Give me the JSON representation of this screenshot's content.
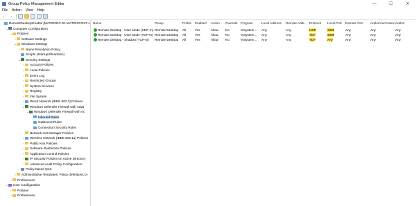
{
  "window": {
    "title": "Group Policy Management Editor",
    "minimize": "—",
    "maximize": "☐",
    "close": "✕"
  },
  "menu": [
    "File",
    "Action",
    "View",
    "Help"
  ],
  "tree": [
    {
      "label": "RemoteDesktopEnable [MATRIXDC-01.MATRIXPOST-LAB",
      "icon": "gpo-icon",
      "exp": "",
      "indent": 0
    },
    {
      "label": "Computer Configuration",
      "icon": "computer-icon",
      "exp": "⌄",
      "indent": 1
    },
    {
      "label": "Policies",
      "icon": "folder-icon",
      "exp": "⌄",
      "indent": 2
    },
    {
      "label": "Software Settings",
      "icon": "folder-icon",
      "exp": "›",
      "indent": 3
    },
    {
      "label": "Windows Settings",
      "icon": "folder-icon",
      "exp": "⌄",
      "indent": 3
    },
    {
      "label": "Name Resolution Policy",
      "icon": "folder-icon",
      "exp": "›",
      "indent": 4
    },
    {
      "label": "Scripts (Startup/Shutdown)",
      "icon": "doc-icon",
      "exp": "",
      "indent": 4
    },
    {
      "label": "Security Settings",
      "icon": "shield-icon",
      "exp": "⌄",
      "indent": 4
    },
    {
      "label": "Account Policies",
      "icon": "folder-icon",
      "exp": "›",
      "indent": 5
    },
    {
      "label": "Local Policies",
      "icon": "folder-icon",
      "exp": "›",
      "indent": 5
    },
    {
      "label": "Event Log",
      "icon": "folder-icon",
      "exp": "›",
      "indent": 5
    },
    {
      "label": "Restricted Groups",
      "icon": "folder-icon",
      "exp": "›",
      "indent": 5
    },
    {
      "label": "System Services",
      "icon": "folder-icon",
      "exp": "›",
      "indent": 5
    },
    {
      "label": "Registry",
      "icon": "folder-icon",
      "exp": "›",
      "indent": 5
    },
    {
      "label": "File System",
      "icon": "folder-icon",
      "exp": "›",
      "indent": 5
    },
    {
      "label": "Wired Network (IEEE 802.3) Policies",
      "icon": "doc-icon",
      "exp": "›",
      "indent": 5
    },
    {
      "label": "Windows Defender Firewall with Adva",
      "icon": "shield-icon",
      "exp": "⌄",
      "indent": 5
    },
    {
      "label": "Windows Defender Firewall with Ac",
      "icon": "shield-icon",
      "exp": "⌄",
      "indent": 6
    },
    {
      "label": "Inbound Rules",
      "icon": "doc-icon",
      "exp": "",
      "indent": 7,
      "selected": true
    },
    {
      "label": "Outbound Rules",
      "icon": "doc-icon",
      "exp": "",
      "indent": 7
    },
    {
      "label": "Connection Security Rules",
      "icon": "doc-icon",
      "exp": "",
      "indent": 7
    },
    {
      "label": "Network List Manager Policies",
      "icon": "folder-icon",
      "exp": "",
      "indent": 5
    },
    {
      "label": "Wireless Network (IEEE 802.11) Policies",
      "icon": "doc-icon",
      "exp": "›",
      "indent": 5
    },
    {
      "label": "Public Key Policies",
      "icon": "folder-icon",
      "exp": "›",
      "indent": 5
    },
    {
      "label": "Software Restriction Policies",
      "icon": "folder-icon",
      "exp": "›",
      "indent": 5
    },
    {
      "label": "Application Control Policies",
      "icon": "folder-icon",
      "exp": "›",
      "indent": 5
    },
    {
      "label": "IP Security Policies on Active Directory",
      "icon": "shield-icon",
      "exp": "›",
      "indent": 5
    },
    {
      "label": "Advanced Audit Policy Configuration",
      "icon": "folder-icon",
      "exp": "›",
      "indent": 5
    },
    {
      "label": "Policy-based QoS",
      "icon": "gear-icon",
      "exp": "›",
      "indent": 4
    },
    {
      "label": "Administrative Templates: Policy definitions (A",
      "icon": "folder-icon",
      "exp": "›",
      "indent": 3
    },
    {
      "label": "Preferences",
      "icon": "folder-icon",
      "exp": "›",
      "indent": 2
    },
    {
      "label": "User Configuration",
      "icon": "user-icon",
      "exp": "⌄",
      "indent": 1
    },
    {
      "label": "Policies",
      "icon": "folder-icon",
      "exp": "›",
      "indent": 2
    },
    {
      "label": "Preferences",
      "icon": "folder-icon",
      "exp": "›",
      "indent": 2
    }
  ],
  "columns": [
    "Name",
    "Group",
    "Profile",
    "Enabled",
    "Action",
    "Override",
    "Program",
    "Local Address",
    "Remote Addr...",
    "Protocol",
    "Local Port",
    "Remote Port",
    "Authorized Users",
    "Author"
  ],
  "rows": [
    [
      "Remote Desktop - User Mode (UDP-In)",
      "Remote Desktop",
      "All",
      "Yes",
      "Allow",
      "No",
      "%System...",
      "Any",
      "Any",
      "UDP",
      "3389",
      "Any",
      "Any",
      "Any"
    ],
    [
      "Remote Desktop - User Mode (TCP-In)",
      "Remote Desktop",
      "All",
      "Yes",
      "Allow",
      "No",
      "%System...",
      "Any",
      "Any",
      "TCP",
      "3389",
      "Any",
      "Any",
      "Any"
    ],
    [
      "Remote Desktop - Shadow (TCP-In)",
      "Remote Desktop",
      "All",
      "Yes",
      "Allow",
      "No",
      "%System...",
      "Any",
      "Any",
      "TCP",
      "Any",
      "Any",
      "Any",
      "Any"
    ]
  ],
  "colors": {
    "highlight": "#ffe74a",
    "selection": "#cce4f7",
    "enabled_icon": "#2e9b3a"
  }
}
